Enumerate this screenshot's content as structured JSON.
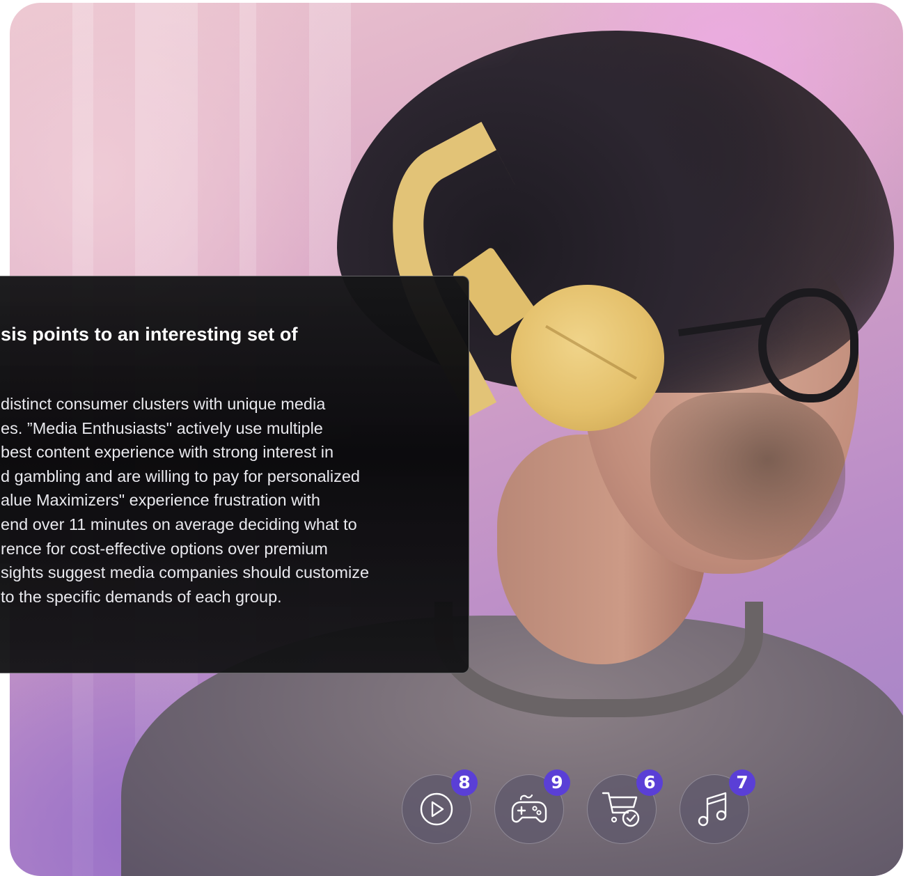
{
  "card": {
    "title_visible": "sis points to an interesting set of",
    "body_lines": [
      "distinct consumer clusters with unique media",
      "es. ”Media Enthusiasts\" actively use multiple",
      "best content experience with strong interest in",
      "d gambling and are willing to pay for personalized",
      "alue Maximizers\" experience frustration with",
      "end over 11 minutes on average deciding what to",
      "rence for cost-effective options over premium",
      "sights suggest media companies should customize",
      "to the specific demands of each group."
    ]
  },
  "categories": [
    {
      "icon": "play-icon",
      "badge": "8"
    },
    {
      "icon": "gamepad-icon",
      "badge": "9"
    },
    {
      "icon": "cart-check-icon",
      "badge": "6"
    },
    {
      "icon": "music-note-icon",
      "badge": "7"
    }
  ],
  "colors": {
    "badge": "#5a3fd6",
    "card_background": "#0d0d0f",
    "icon_button": "#5f586c"
  }
}
